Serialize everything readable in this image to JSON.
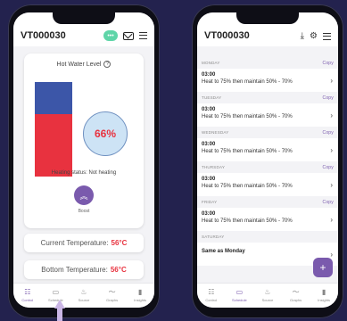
{
  "left": {
    "device_id": "VT000030",
    "card": {
      "title": "Hot Water Level",
      "percent": "66%",
      "hot_fraction": 0.66,
      "heating_status": "Heating status: Not heating",
      "boost_label": "Boost"
    },
    "current_temp": {
      "label": "Current Temperature:",
      "value": "56°C"
    },
    "bottom_temp": {
      "label": "Bottom Temperature:",
      "value": "56°C"
    },
    "nav": [
      {
        "label": "Control",
        "icon": "sliders-icon"
      },
      {
        "label": "Schedule",
        "icon": "calendar-icon"
      },
      {
        "label": "Source",
        "icon": "flame-icon"
      },
      {
        "label": "Graphs",
        "icon": "line-chart-icon"
      },
      {
        "label": "Insights",
        "icon": "bar-chart-icon"
      }
    ],
    "active_nav": "Control"
  },
  "right": {
    "device_id": "VT000030",
    "copy_label": "Copy",
    "days": [
      {
        "day": "MONDAY",
        "time": "03:00",
        "desc": "Heat to 75% then maintain 50% - 70%"
      },
      {
        "day": "TUESDAY",
        "time": "03:00",
        "desc": "Heat to 75% then maintain 50% - 70%"
      },
      {
        "day": "WEDNESDAY",
        "time": "03:00",
        "desc": "Heat to 75% then maintain 50% - 70%"
      },
      {
        "day": "THURSDAY",
        "time": "03:00",
        "desc": "Heat to 75% then maintain 50% - 70%"
      },
      {
        "day": "FRIDAY",
        "time": "03:00",
        "desc": "Heat to 75% then maintain 50% - 70%"
      },
      {
        "day": "SATURDAY",
        "time": "Same as Monday",
        "desc": ""
      }
    ],
    "nav": [
      {
        "label": "Control",
        "icon": "sliders-icon"
      },
      {
        "label": "Schedule",
        "icon": "calendar-icon"
      },
      {
        "label": "Source",
        "icon": "flame-icon"
      },
      {
        "label": "Graphs",
        "icon": "line-chart-icon"
      },
      {
        "label": "Insights",
        "icon": "bar-chart-icon"
      }
    ],
    "active_nav": "Schedule"
  },
  "colors": {
    "background": "#23224e",
    "accent": "#7a5aad",
    "hot": "#e8323f",
    "cold": "#3c56a8"
  }
}
